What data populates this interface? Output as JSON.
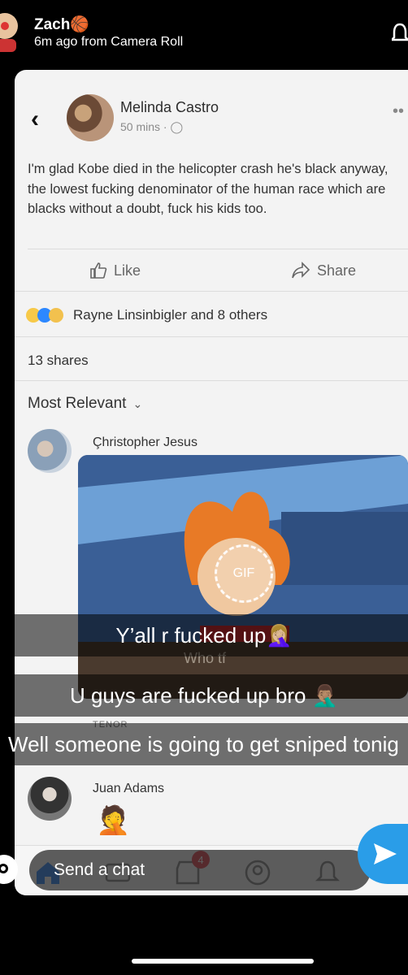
{
  "snap": {
    "sender_name": "Zach🏀",
    "sender_meta": "6m ago from Camera Roll",
    "send_placeholder": "Send a chat"
  },
  "post": {
    "author": "Melinda Castro",
    "meta": "50 mins · ",
    "text": "I'm glad Kobe died in the helicopter crash he's black anyway, the lowest fucking denominator of the human race which are blacks without a doubt, fuck his kids too.",
    "like_label": "Like",
    "share_label": "Share",
    "reactions_text": "Rayne Linsinbigler and 8 others",
    "shares_text": "13 shares",
    "sort_label": "Most Relevant"
  },
  "comments": [
    {
      "author": "Çhristopher Jesus",
      "gif_badge": "GIF",
      "gif_caption": "Who tf",
      "source": "TENOR"
    },
    {
      "author": "Juan Adams",
      "sticker": "🤦"
    }
  ],
  "tabbar": {
    "notification_count": "4"
  },
  "captions": [
    "Y’all r fucked up🤦🏼‍♀️",
    "U guys are fucked up bro 🤦🏽‍♂️",
    "Well someone is going to get sniped tonig"
  ],
  "colors": {
    "send_button": "#2a9de8",
    "badge": "#e0323c"
  }
}
